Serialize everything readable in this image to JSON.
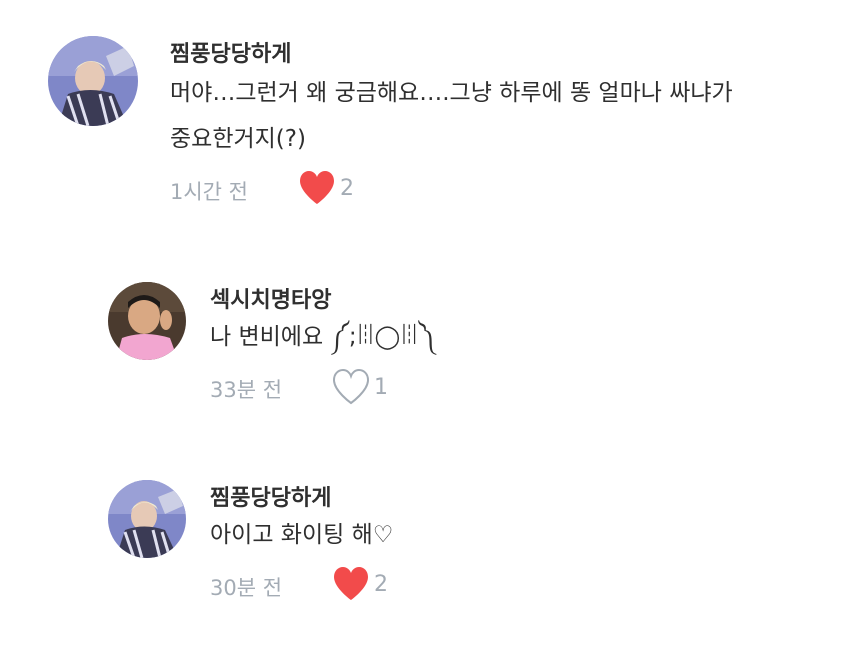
{
  "comments": [
    {
      "author": "찜풍당당하게",
      "text_line1": "머야…그런거 왜 궁금해요….그냥 하루에 똥 얼마나 싸냐가",
      "text_line2": "중요한거지(?)",
      "time": "1시간 전",
      "likes": "2",
      "liked": true
    },
    {
      "author": "섹시치명타앙",
      "text_line1": "나 변비에요 ༼;ꈨ◯ꈨ༽",
      "time": "33분 전",
      "likes": "1",
      "liked": false
    },
    {
      "author": "찜풍당당하게",
      "text_line1": "아이고 화이팅 해♡",
      "time": "30분 전",
      "likes": "2",
      "liked": true
    }
  ],
  "colors": {
    "heart_filled": "#f24b4b",
    "meta_gray": "#a3abb4"
  },
  "icons": {
    "liked": "heart-filled-icon",
    "unliked": "heart-outline-icon"
  }
}
